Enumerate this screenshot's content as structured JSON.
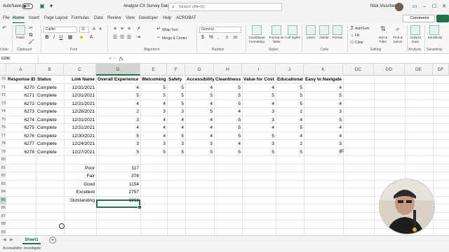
{
  "titlebar": {
    "autosave_label": "AutoSave",
    "autosave_state": "Off",
    "doc_title": "Analyze CX Survey Data.xlsx",
    "search_placeholder": "Search (Alt+Q)",
    "user_name": "Nick Visscher",
    "accent_color": "#217346"
  },
  "tabs": [
    {
      "label": "File"
    },
    {
      "label": "Home"
    },
    {
      "label": "Insert"
    },
    {
      "label": "Page Layout"
    },
    {
      "label": "Formulas"
    },
    {
      "label": "Data"
    },
    {
      "label": "Review"
    },
    {
      "label": "View"
    },
    {
      "label": "Developer"
    },
    {
      "label": "Help"
    },
    {
      "label": "ACROBAT"
    }
  ],
  "ribbon_actions": {
    "comments_label": "Comments"
  },
  "ribbon": {
    "undo_label": "Undo",
    "paste_label": "Paste",
    "clipboard_label": "Clipboard",
    "font_name": "Calibri",
    "font_size": "11",
    "font_label": "Font",
    "wrap_text": "Wrap Text",
    "merge_center": "Merge & Center",
    "alignment_label": "Alignment",
    "number_format": "General",
    "number_label": "Number",
    "conditional_formatting": "Conditional Formatting",
    "format_as_table": "Format as Table",
    "cell_styles": "Cell Styles",
    "styles_label": "Styles",
    "insert": "Insert",
    "delete": "Delete",
    "format": "Format",
    "cells_label": "Cells",
    "autosum": "AutoSum",
    "fill": "Fill",
    "clear": "Clear",
    "sort_filter": "Sort & Filter",
    "find_select": "Find & Select",
    "editing_label": "Editing",
    "analyze_data": "Analyze Data",
    "analysis_label": "Analysis",
    "sensitivity": "Sensitivity",
    "sensitivity_label": "Sensitivity"
  },
  "formula_bar": {
    "name_box": "6286",
    "fx": "fx",
    "content": ""
  },
  "columns": [
    "A",
    "B",
    "C",
    "D",
    "E",
    "F",
    "G",
    "H",
    "I",
    "J",
    "K",
    "DC",
    "DD",
    "DE",
    "DF"
  ],
  "row_numbers": [
    "70",
    "71",
    "72",
    "73",
    "74",
    "75",
    "76",
    "77",
    "78",
    "79",
    "80",
    "81",
    "82",
    "83",
    "84",
    "85",
    "86",
    "87",
    "88",
    "89"
  ],
  "header_row": {
    "response_id": "Response ID",
    "status": "Status",
    "link_name": "Link Name",
    "overall": "Overall Experience",
    "welcoming": "Welcoming",
    "safety": "Safety",
    "accessibility": "Accessibility",
    "cleanliness": "Cleanliness",
    "value_for_cost": "Value for Cost",
    "educational": "Educational",
    "easy_to_navigate": "Easy to Navigate"
  },
  "data_rows": [
    {
      "id": "6270",
      "status": "Complete",
      "date": "12/31/2021",
      "overall": "4",
      "welcoming": "5",
      "safety": "5",
      "accessibility": "4",
      "cleanliness": "5",
      "value": "4",
      "educational": "5",
      "easy": "4"
    },
    {
      "id": "6271",
      "status": "Complete",
      "date": "12/31/2021",
      "overall": "5",
      "welcoming": "5",
      "safety": "5",
      "accessibility": "5",
      "cleanliness": "5",
      "value": "5",
      "educational": "5",
      "easy": "5"
    },
    {
      "id": "6272",
      "status": "Complete",
      "date": "12/31/2021",
      "overall": "4",
      "welcoming": "4",
      "safety": "5",
      "accessibility": "4",
      "cleanliness": "5",
      "value": "4",
      "educational": "5",
      "easy": "4"
    },
    {
      "id": "6273",
      "status": "Complete",
      "date": "12/28/2021",
      "overall": "2",
      "welcoming": "3",
      "safety": "3",
      "accessibility": "5",
      "cleanliness": "4",
      "value": "3",
      "educational": "2",
      "easy": "3"
    },
    {
      "id": "6274",
      "status": "Complete",
      "date": "12/31/2021",
      "overall": "3",
      "welcoming": "4",
      "safety": "4",
      "accessibility": "4",
      "cleanliness": "5",
      "value": "3",
      "educational": "4",
      "easy": "5"
    },
    {
      "id": "6275",
      "status": "Complete",
      "date": "12/31/2021",
      "overall": "4",
      "welcoming": "4",
      "safety": "4",
      "accessibility": "4",
      "cleanliness": "5",
      "value": "4",
      "educational": "5",
      "easy": "4"
    },
    {
      "id": "6276",
      "status": "Complete",
      "date": "12/30/2021",
      "overall": "5",
      "welcoming": "4",
      "safety": "5",
      "accessibility": "4",
      "cleanliness": "5",
      "value": "5",
      "educational": "4",
      "easy": "4"
    },
    {
      "id": "6277",
      "status": "Complete",
      "date": "12/24/2021",
      "overall": "3",
      "welcoming": "3",
      "safety": "3",
      "accessibility": "3",
      "cleanliness": "4",
      "value": "3",
      "educational": "2",
      "easy": "3"
    },
    {
      "id": "6278",
      "status": "Complete",
      "date": "12/27/2021",
      "overall": "5",
      "welcoming": "5",
      "safety": "5",
      "accessibility": "5",
      "cleanliness": "5",
      "value": "5",
      "educational": "5",
      "easy": "5"
    }
  ],
  "summary": [
    {
      "label": "Poor",
      "value": "117"
    },
    {
      "label": "Fair",
      "value": "378"
    },
    {
      "label": "Good",
      "value": "1154"
    },
    {
      "label": "Excellent",
      "value": "2757"
    },
    {
      "label": "Outstanding",
      "value": "1863"
    }
  ],
  "sheet": {
    "tab_name": "Sheet1",
    "add_symbol": "+"
  },
  "status_bar": {
    "accessibility": "Accessibility: Investigate"
  }
}
